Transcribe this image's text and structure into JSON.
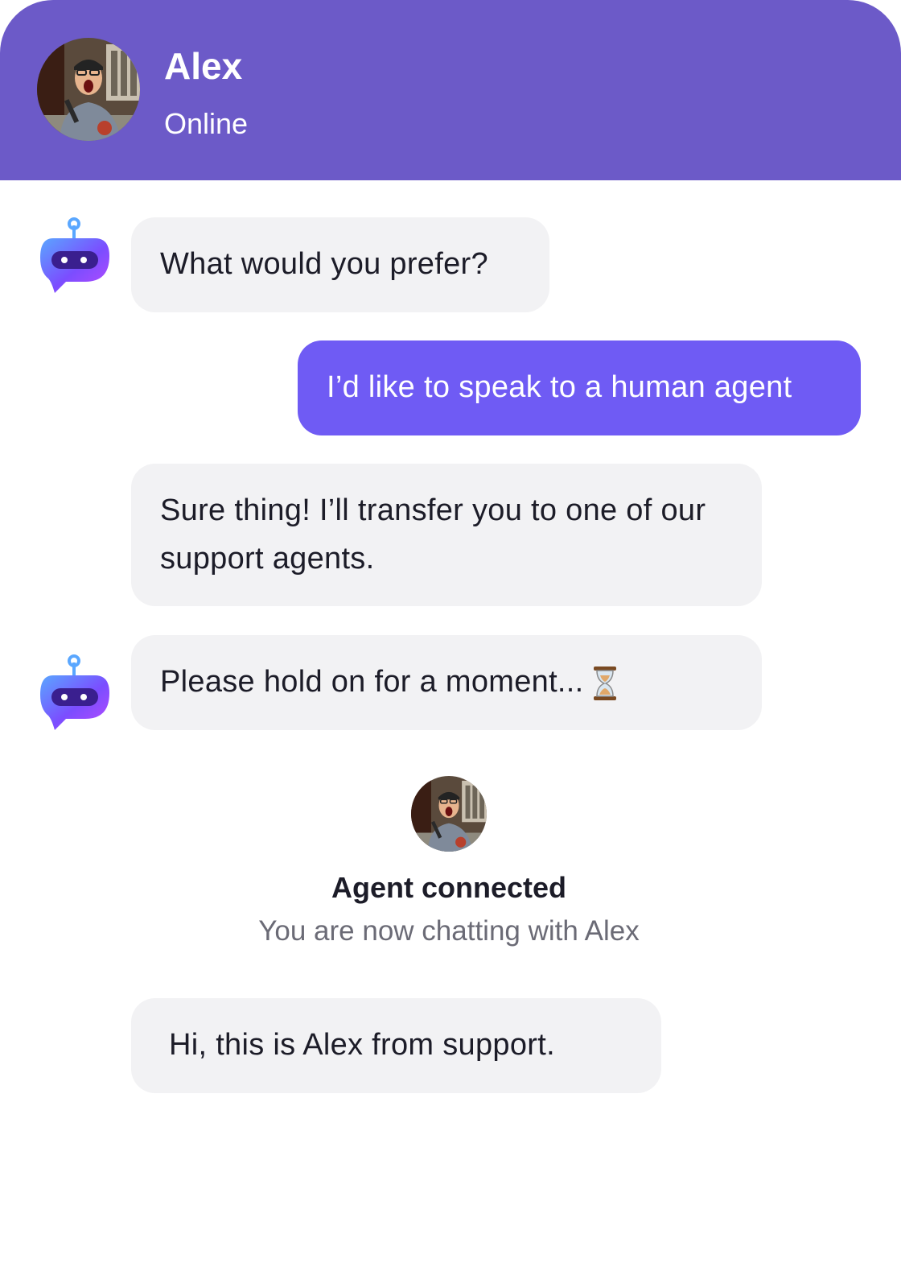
{
  "header": {
    "agent_name": "Alex",
    "status": "Online"
  },
  "messages": [
    {
      "sender": "bot",
      "text": "What would you prefer?"
    },
    {
      "sender": "user",
      "text": "I’d like to speak to a human agent"
    },
    {
      "sender": "bot",
      "text": "Sure thing! I’ll transfer you to one of our support agents."
    },
    {
      "sender": "bot",
      "text": "Please hold on for a moment...",
      "icon": "hourglass-icon"
    },
    {
      "sender": "agent",
      "text": "Hi, this is Alex from support."
    }
  ],
  "agent_connected": {
    "title": "Agent connected",
    "subtitle": "You are now chatting with Alex"
  },
  "colors": {
    "header_bg": "#6c5ac8",
    "user_bubble": "#6f5bf4",
    "bot_bubble": "#f2f2f4"
  }
}
